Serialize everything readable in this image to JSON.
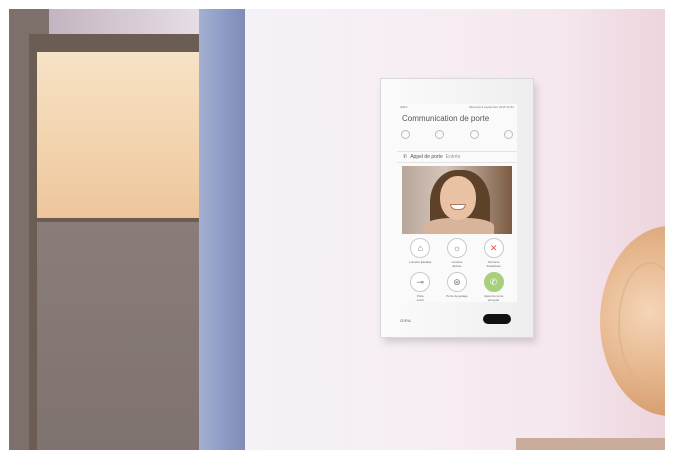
{
  "scene": {
    "description_free": true
  },
  "device": {
    "brand": "GIRA",
    "screen": {
      "status_left": "GIRA",
      "status_right": "Mercredi 9 septembre 2015 10:42",
      "title": "Communication de porte",
      "notification_text": "Appel de porte",
      "notification_accent": "Entrée",
      "buttons": [
        {
          "label": "Lumière Escalier",
          "sub": "",
          "icon": "camera-icon",
          "symbol": "⌂",
          "style": ""
        },
        {
          "label": "Lumière",
          "sub": "Entrée",
          "icon": "bulb-icon",
          "symbol": "☼",
          "style": ""
        },
        {
          "label": "Sonnerie",
          "sub": "désactivée",
          "icon": "bell-off-icon",
          "symbol": "✕",
          "style": "warn"
        },
        {
          "label": "Porte",
          "sub": "ouvrir",
          "icon": "key-icon",
          "symbol": "⊸",
          "style": ""
        },
        {
          "label": "Porte de garage",
          "sub": "",
          "icon": "garage-icon",
          "symbol": "⊛",
          "style": ""
        },
        {
          "label": "Appel de porte",
          "sub": "accepter",
          "icon": "phone-icon",
          "symbol": "✆",
          "style": "green"
        }
      ]
    }
  },
  "colors": {
    "accent_green": "#a8d07c",
    "warning_red": "#d9584f",
    "panel": "#f4f4f5"
  }
}
